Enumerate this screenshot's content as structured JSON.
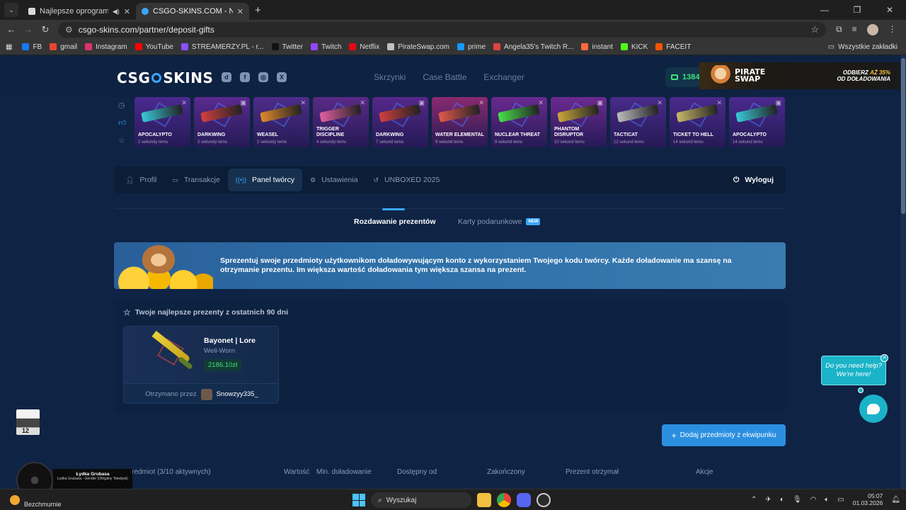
{
  "browser": {
    "tabs": [
      {
        "title": "Najlepsze oprogramowanie",
        "active": false,
        "favicon_color": "#d9d9d9"
      },
      {
        "title": "CSGO-SKINS.COM - Najlepsze",
        "active": true,
        "favicon_color": "#3aa6ff"
      }
    ],
    "url": "csgo-skins.com/partner/deposit-gifts",
    "bookmarks": [
      {
        "label": "FB",
        "color": "#1877f2"
      },
      {
        "label": "gmail",
        "color": "#ea4335"
      },
      {
        "label": "Instagram",
        "color": "#e1306c"
      },
      {
        "label": "YouTube",
        "color": "#ff0000"
      },
      {
        "label": "STREAMERZY.PL - r...",
        "color": "#8a4fff"
      },
      {
        "label": "Twitter",
        "color": "#111111"
      },
      {
        "label": "Twitch",
        "color": "#9146ff"
      },
      {
        "label": "Netflix",
        "color": "#e50914"
      },
      {
        "label": "PirateSwap.com",
        "color": "#c0c0c0"
      },
      {
        "label": "prime",
        "color": "#1399ff"
      },
      {
        "label": "Angela35's Twitch R...",
        "color": "#d44"
      },
      {
        "label": "instant",
        "color": "#ff6a3d"
      },
      {
        "label": "KICK",
        "color": "#53fc18"
      },
      {
        "label": "FACEIT",
        "color": "#ff5500"
      }
    ],
    "all_bookmarks": "Wszystkie zakładki"
  },
  "header": {
    "logo": "CSG SKINS",
    "nav": [
      "Skrzynki",
      "Case Battle",
      "Exchanger"
    ],
    "balance": "1384",
    "ad": {
      "brand_line1": "PIRATE",
      "brand_line2": "SWAP",
      "promo_line1": "ODBIERZ",
      "promo_pct": "AŻ 35%",
      "promo_line2": "OD DOŁADOWANIA"
    }
  },
  "drops": [
    {
      "name": "APOCALYPTO",
      "time": "2 sekundy temu",
      "bg": "#4b2a8f",
      "gun": "#39c9d6"
    },
    {
      "name": "DARKWING",
      "time": "2 sekundy temu",
      "bg": "#5a2a8f",
      "gun": "#d04040"
    },
    {
      "name": "WEASEL",
      "time": "2 sekundy temu",
      "bg": "#4e2d8a",
      "gun": "#e08a2a"
    },
    {
      "name": "TRIGGER DISCIPLINE",
      "time": "4 sekundy temu",
      "bg": "#5a2a86",
      "gun": "#e060a0"
    },
    {
      "name": "DARKWING",
      "time": "7 sekund temu",
      "bg": "#55288a",
      "gun": "#d04040"
    },
    {
      "name": "WATER ELEMENTAL",
      "time": "9 sekund temu",
      "bg": "#8a2a6f",
      "gun": "#e05a4a"
    },
    {
      "name": "NUCLEAR THREAT",
      "time": "9 sekund temu",
      "bg": "#6a2a8f",
      "gun": "#49e04a"
    },
    {
      "name": "PHANTOM DISRUPTOR",
      "time": "10 sekund temu",
      "bg": "#6d2a90",
      "gun": "#c8a83a"
    },
    {
      "name": "TACTICAT",
      "time": "12 sekund temu",
      "bg": "#4a2a8a",
      "gun": "#bcbcbc"
    },
    {
      "name": "TICKET TO HELL",
      "time": "14 sekund temu",
      "bg": "#4b2a8c",
      "gun": "#c9b86a"
    },
    {
      "name": "APOCALYPTO",
      "time": "14 sekund temu",
      "bg": "#4b2a8f",
      "gun": "#39c9d6"
    }
  ],
  "account_nav": {
    "profile": "Profil",
    "transactions": "Transakcje",
    "creator_panel": "Panel twórcy",
    "settings": "Ustawienia",
    "unboxed": "UNBOXED 2025",
    "logout": "Wyloguj"
  },
  "subtabs": {
    "gifts": "Rozdawanie prezentów",
    "cards": "Karty podarunkowe",
    "new_badge": "NEW"
  },
  "banner_text": "Sprezentuj swoje przedmioty użytkownikom doładowywującym konto z wykorzystaniem Twojego kodu twórcy. Każde doładowanie ma szansę na otrzymanie prezentu. Im większa wartość doładowania tym większa szansa na prezent.",
  "gifts": {
    "heading": "Twoje najlepsze prezenty z ostatnich 90 dni",
    "card": {
      "name": "Bayonet | Lore",
      "wear": "Well-Worn",
      "price": "2186.10zł",
      "received_label": "Otrzymano przez",
      "user": "Snowzyy335_"
    }
  },
  "add_button": "Dodaj przedmioty z ekwipunku",
  "table_columns": [
    "redmiot (3/10 aktywnych)",
    "Wartość",
    "Min. doładowanie",
    "Dostępny od",
    "Zakończony",
    "Prezent otrzymał",
    "Akcje"
  ],
  "help": {
    "line1": "Do you need help?",
    "line2": "We're here!"
  },
  "overlay": {
    "music_title": "Łydka Grubasa",
    "music_sub": "Łydka Grubasa - Gender (Oficjalny Teledysk)",
    "cam_label": "12"
  },
  "taskbar": {
    "weather": "Bezchmurnie",
    "search": "Wyszukaj",
    "time": "05:07",
    "date": "01.03.2026"
  }
}
